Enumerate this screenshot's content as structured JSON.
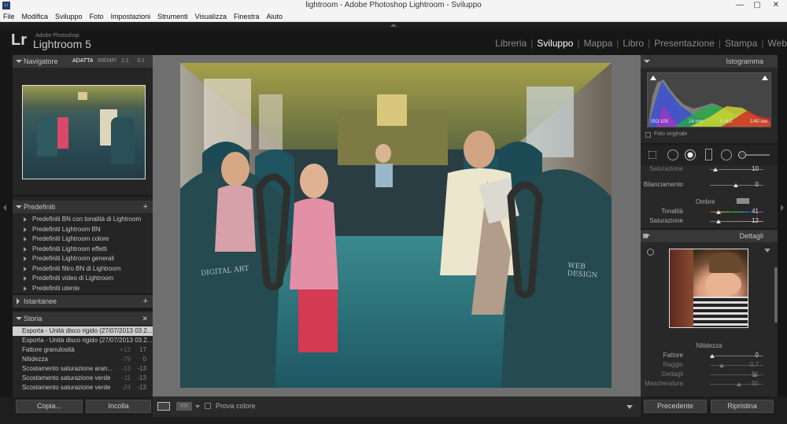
{
  "window": {
    "title": "lightroom - Adobe Photoshop Lightroom - Sviluppo",
    "minimize": "—",
    "maximize": "▢",
    "close": "✕"
  },
  "menu": [
    "File",
    "Modifica",
    "Sviluppo",
    "Foto",
    "Impostazioni",
    "Strumenti",
    "Visualizza",
    "Finestra",
    "Aiuto"
  ],
  "brand": {
    "mark": "Lr",
    "adobe": "Adobe Photoshop",
    "product": "Lightroom 5"
  },
  "modules": [
    {
      "label": "Libreria",
      "active": false
    },
    {
      "label": "Sviluppo",
      "active": true
    },
    {
      "label": "Mappa",
      "active": false
    },
    {
      "label": "Libro",
      "active": false
    },
    {
      "label": "Presentazione",
      "active": false
    },
    {
      "label": "Stampa",
      "active": false
    },
    {
      "label": "Web",
      "active": false
    }
  ],
  "navigator": {
    "title": "Navigatore",
    "zoom": [
      "ADATTA",
      "RIEMPI",
      "1:1",
      "3:1"
    ]
  },
  "presets": {
    "title": "Predefiniti",
    "add": "+",
    "items": [
      "Predefiniti BN con tonalità di Lightroom",
      "Predefiniti Lightroom BN",
      "Predefiniti Lightroom colore",
      "Predefiniti Lightroom effetti",
      "Predefiniti Lightroom generali",
      "Predefiniti filtro BN di Lightroom",
      "Predefiniti video di Lightroom",
      "Predefiniti utente"
    ]
  },
  "snapshots": {
    "title": "Istantanee",
    "add": "+"
  },
  "history": {
    "title": "Storia",
    "close": "✕",
    "items": [
      {
        "label": "Esporta - Unità disco rigido (27/07/2013 03.2...",
        "n1": "",
        "n2": ""
      },
      {
        "label": "Esporta - Unità disco rigido (27/07/2013 03.2...",
        "n1": "",
        "n2": ""
      },
      {
        "label": "Fattore granulosità",
        "n1": "+12",
        "n2": "17"
      },
      {
        "label": "Nitidezza",
        "n1": "-79",
        "n2": "0"
      },
      {
        "label": "Scostamento saturazione aran...",
        "n1": "-13",
        "n2": "-13"
      },
      {
        "label": "Scostamento saturazione verde",
        "n1": "-11",
        "n2": "-13"
      },
      {
        "label": "Scostamento saturazione verde",
        "n1": "-24",
        "n2": "-13"
      }
    ]
  },
  "leftButtons": {
    "copy": "Copia...",
    "paste": "Incolla"
  },
  "toolbar": {
    "yy": "Y|Y",
    "softproof": "Prova colore"
  },
  "histogram": {
    "title": "Istogramma",
    "iso": "ISO 100",
    "focal": "14 mm",
    "aperture": "f / 4,0",
    "shutter": "1/40 sec",
    "original": "Foto originale"
  },
  "splitTone": {
    "sat_top_label": "Saturazione",
    "sat_top_val": "10",
    "balance_label": "Bilanciamento",
    "balance_val": "0",
    "shadows_label": "Ombre",
    "hue_label": "Tonalità",
    "hue_val": "41",
    "sat_label": "Saturazione",
    "sat_val": "12"
  },
  "detail": {
    "title": "Dettagli",
    "sharpening": "Nitidezza",
    "amount_label": "Fattore",
    "amount_val": "0",
    "radius_label": "Raggio",
    "radius_val": "0,7",
    "detail_label": "Dettagli",
    "detail_val": "81",
    "mask_label": "Mascheratura",
    "mask_val": "50"
  },
  "rightButtons": {
    "previous": "Precedente",
    "reset": "Ripristina"
  },
  "photo": {
    "watermark_left": "DIGITAL ART",
    "watermark_right": "WEB DESIGN"
  },
  "colors": {
    "accent": "#ffffff",
    "panel": "#282828",
    "bg": "#1b1b1b"
  }
}
